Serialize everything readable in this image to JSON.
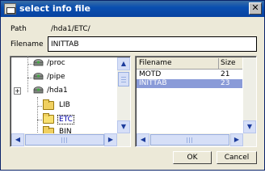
{
  "window": {
    "title": "select info file",
    "close_glyph": "✕"
  },
  "path": {
    "label": "Path",
    "value": "/hda1/ETC/"
  },
  "filename": {
    "label": "Filename",
    "value": "INITTAB"
  },
  "tree": {
    "items": [
      {
        "label": "/proc",
        "icon": "drive-icon"
      },
      {
        "label": "/pipe",
        "icon": "drive-icon"
      },
      {
        "label": "/hda1",
        "icon": "drive-icon",
        "expander": "+"
      },
      {
        "label": "LIB",
        "icon": "folder-icon"
      },
      {
        "label": "ETC",
        "icon": "folder-open-icon",
        "selected": true
      },
      {
        "label": "BIN",
        "icon": "folder-icon"
      }
    ]
  },
  "file_list": {
    "columns": [
      "Filename",
      "Size"
    ],
    "rows": [
      {
        "name": "MOTD",
        "size": "21"
      },
      {
        "name": "INITTAB",
        "size": "23",
        "selected": true
      }
    ]
  },
  "buttons": {
    "ok": "OK",
    "cancel": "Cancel"
  },
  "scroll_glyphs": {
    "up": "▲",
    "down": "▼",
    "left": "◀",
    "right": "▶"
  },
  "colors": {
    "title_bar": "#0a4fb0",
    "selection": "#8a9bd8",
    "dialog_bg": "#ece9d8"
  }
}
